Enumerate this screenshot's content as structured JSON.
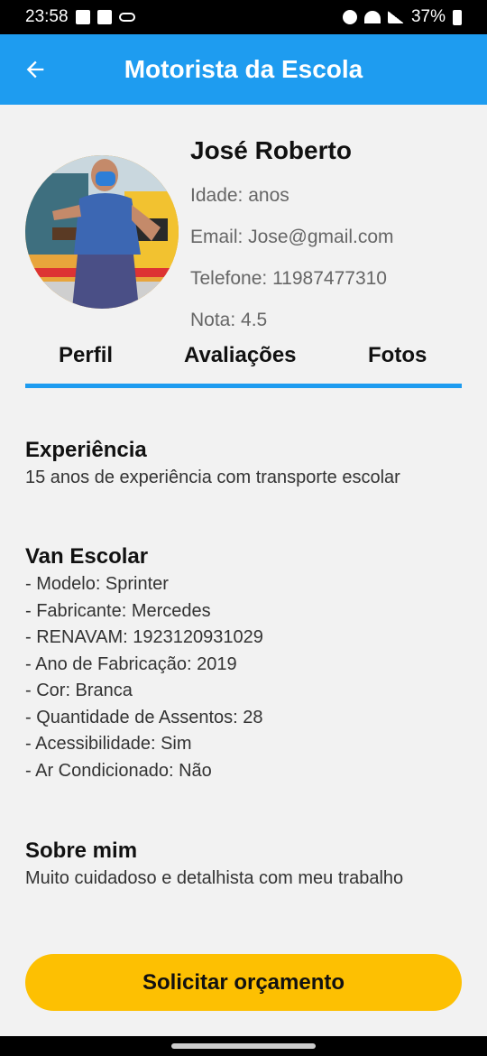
{
  "status_bar": {
    "time": "23:58",
    "battery": "37%"
  },
  "app_bar": {
    "title": "Motorista da Escola"
  },
  "profile": {
    "name": "José Roberto",
    "age_line": "Idade:  anos",
    "email_line": "Email: Jose@gmail.com",
    "phone_line": "Telefone: 11987477310",
    "rating_line": "Nota:  4.5"
  },
  "tabs": [
    {
      "label": "Perfil"
    },
    {
      "label": "Avaliações"
    },
    {
      "label": "Fotos"
    }
  ],
  "experience": {
    "title": "Experiência",
    "text": "15 anos de experiência com transporte escolar"
  },
  "van": {
    "title": "Van Escolar",
    "items": [
      "- Modelo: Sprinter",
      "- Fabricante: Mercedes",
      "- RENAVAM: 1923120931029",
      "- Ano de Fabricação: 2019",
      "- Cor: Branca",
      "- Quantidade de Assentos: 28",
      "- Acessibilidade: Sim",
      "- Ar Condicionado: Não"
    ]
  },
  "about": {
    "title": "Sobre mim",
    "text": "Muito cuidadoso e detalhista com meu trabalho"
  },
  "cta": {
    "label": "Solicitar orçamento"
  },
  "colors": {
    "primary": "#1e9cf0",
    "cta": "#fdc002",
    "background": "#f2f2f2"
  }
}
